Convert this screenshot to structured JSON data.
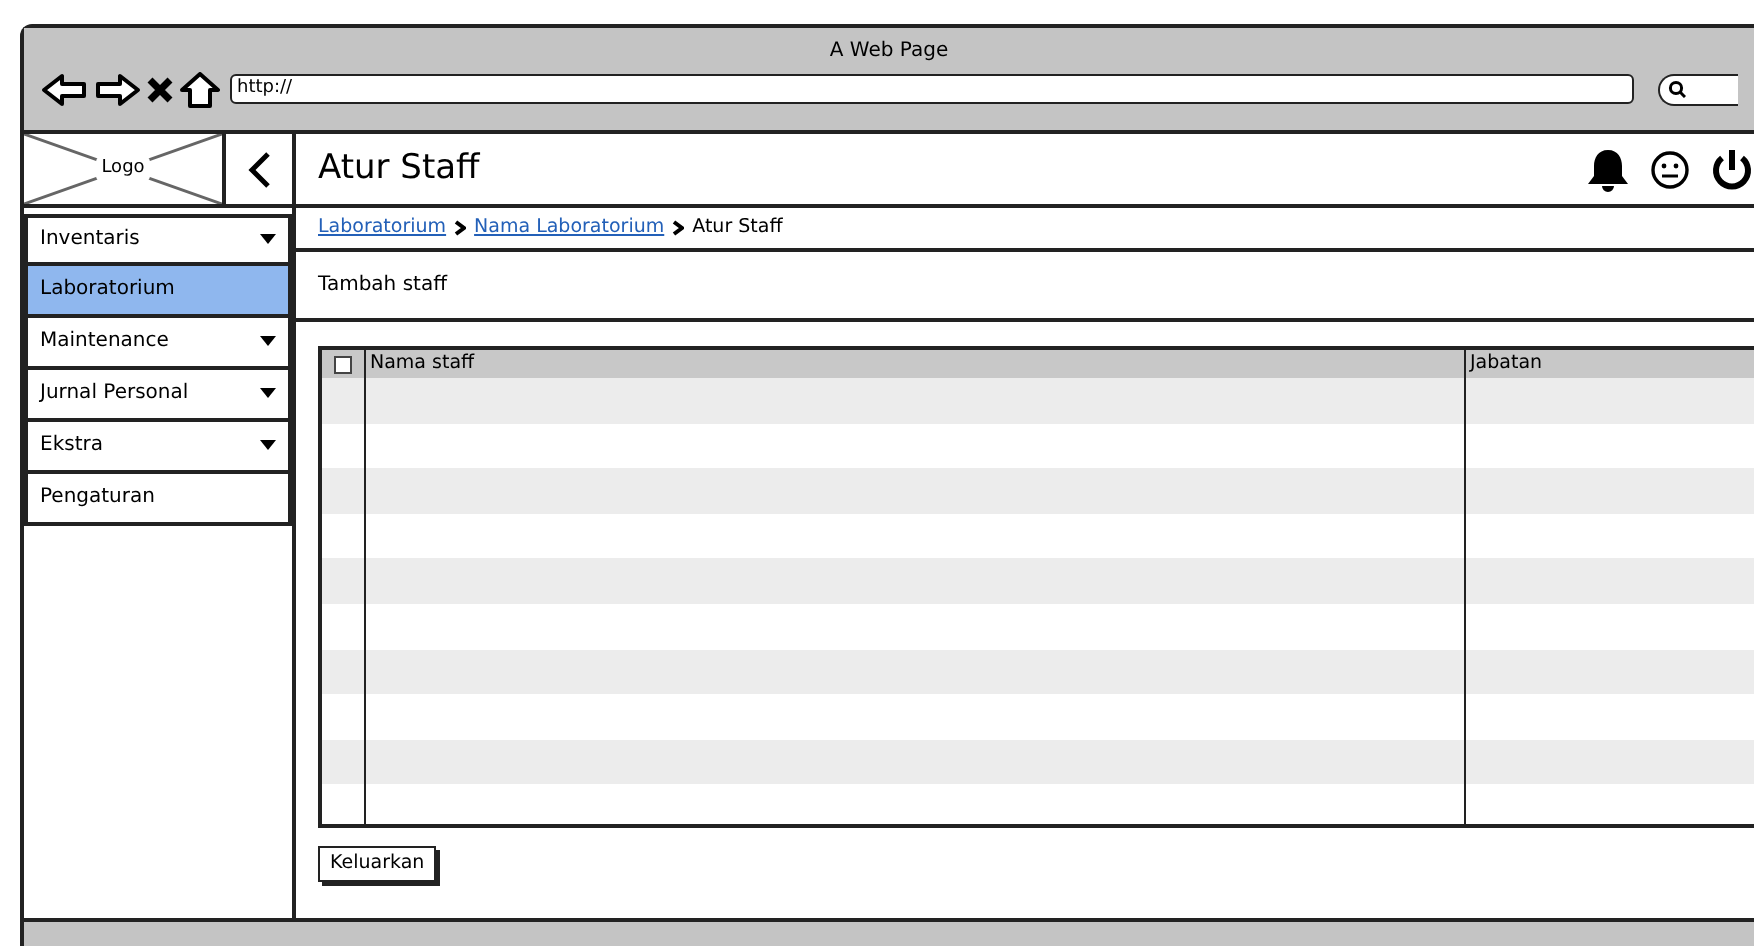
{
  "window": {
    "title": "A Web Page",
    "address": "http://"
  },
  "logo": {
    "label": "Logo"
  },
  "page_title": "Atur Staff",
  "sidebar": {
    "items": [
      {
        "label": "Inventaris",
        "kind": "dropdown",
        "selected": false
      },
      {
        "label": "Laboratorium",
        "kind": "link",
        "selected": true
      },
      {
        "label": "Maintenance",
        "kind": "dropdown",
        "selected": false
      },
      {
        "label": "Jurnal Personal",
        "kind": "dropdown",
        "selected": false
      },
      {
        "label": "Ekstra",
        "kind": "dropdown",
        "selected": false
      },
      {
        "label": "Pengaturan",
        "kind": "link",
        "selected": false
      }
    ]
  },
  "breadcrumb": [
    {
      "label": "Laboratorium",
      "kind": "link"
    },
    {
      "label": "Nama Laboratorium",
      "kind": "link"
    },
    {
      "label": "Atur Staff",
      "kind": "current"
    }
  ],
  "actions": [
    "Tambah staff"
  ],
  "table": {
    "select_all": {
      "checked": false
    },
    "columns": [
      "Nama staff",
      "Jabatan"
    ]
  },
  "buttons": [
    "Keluarkan"
  ]
}
